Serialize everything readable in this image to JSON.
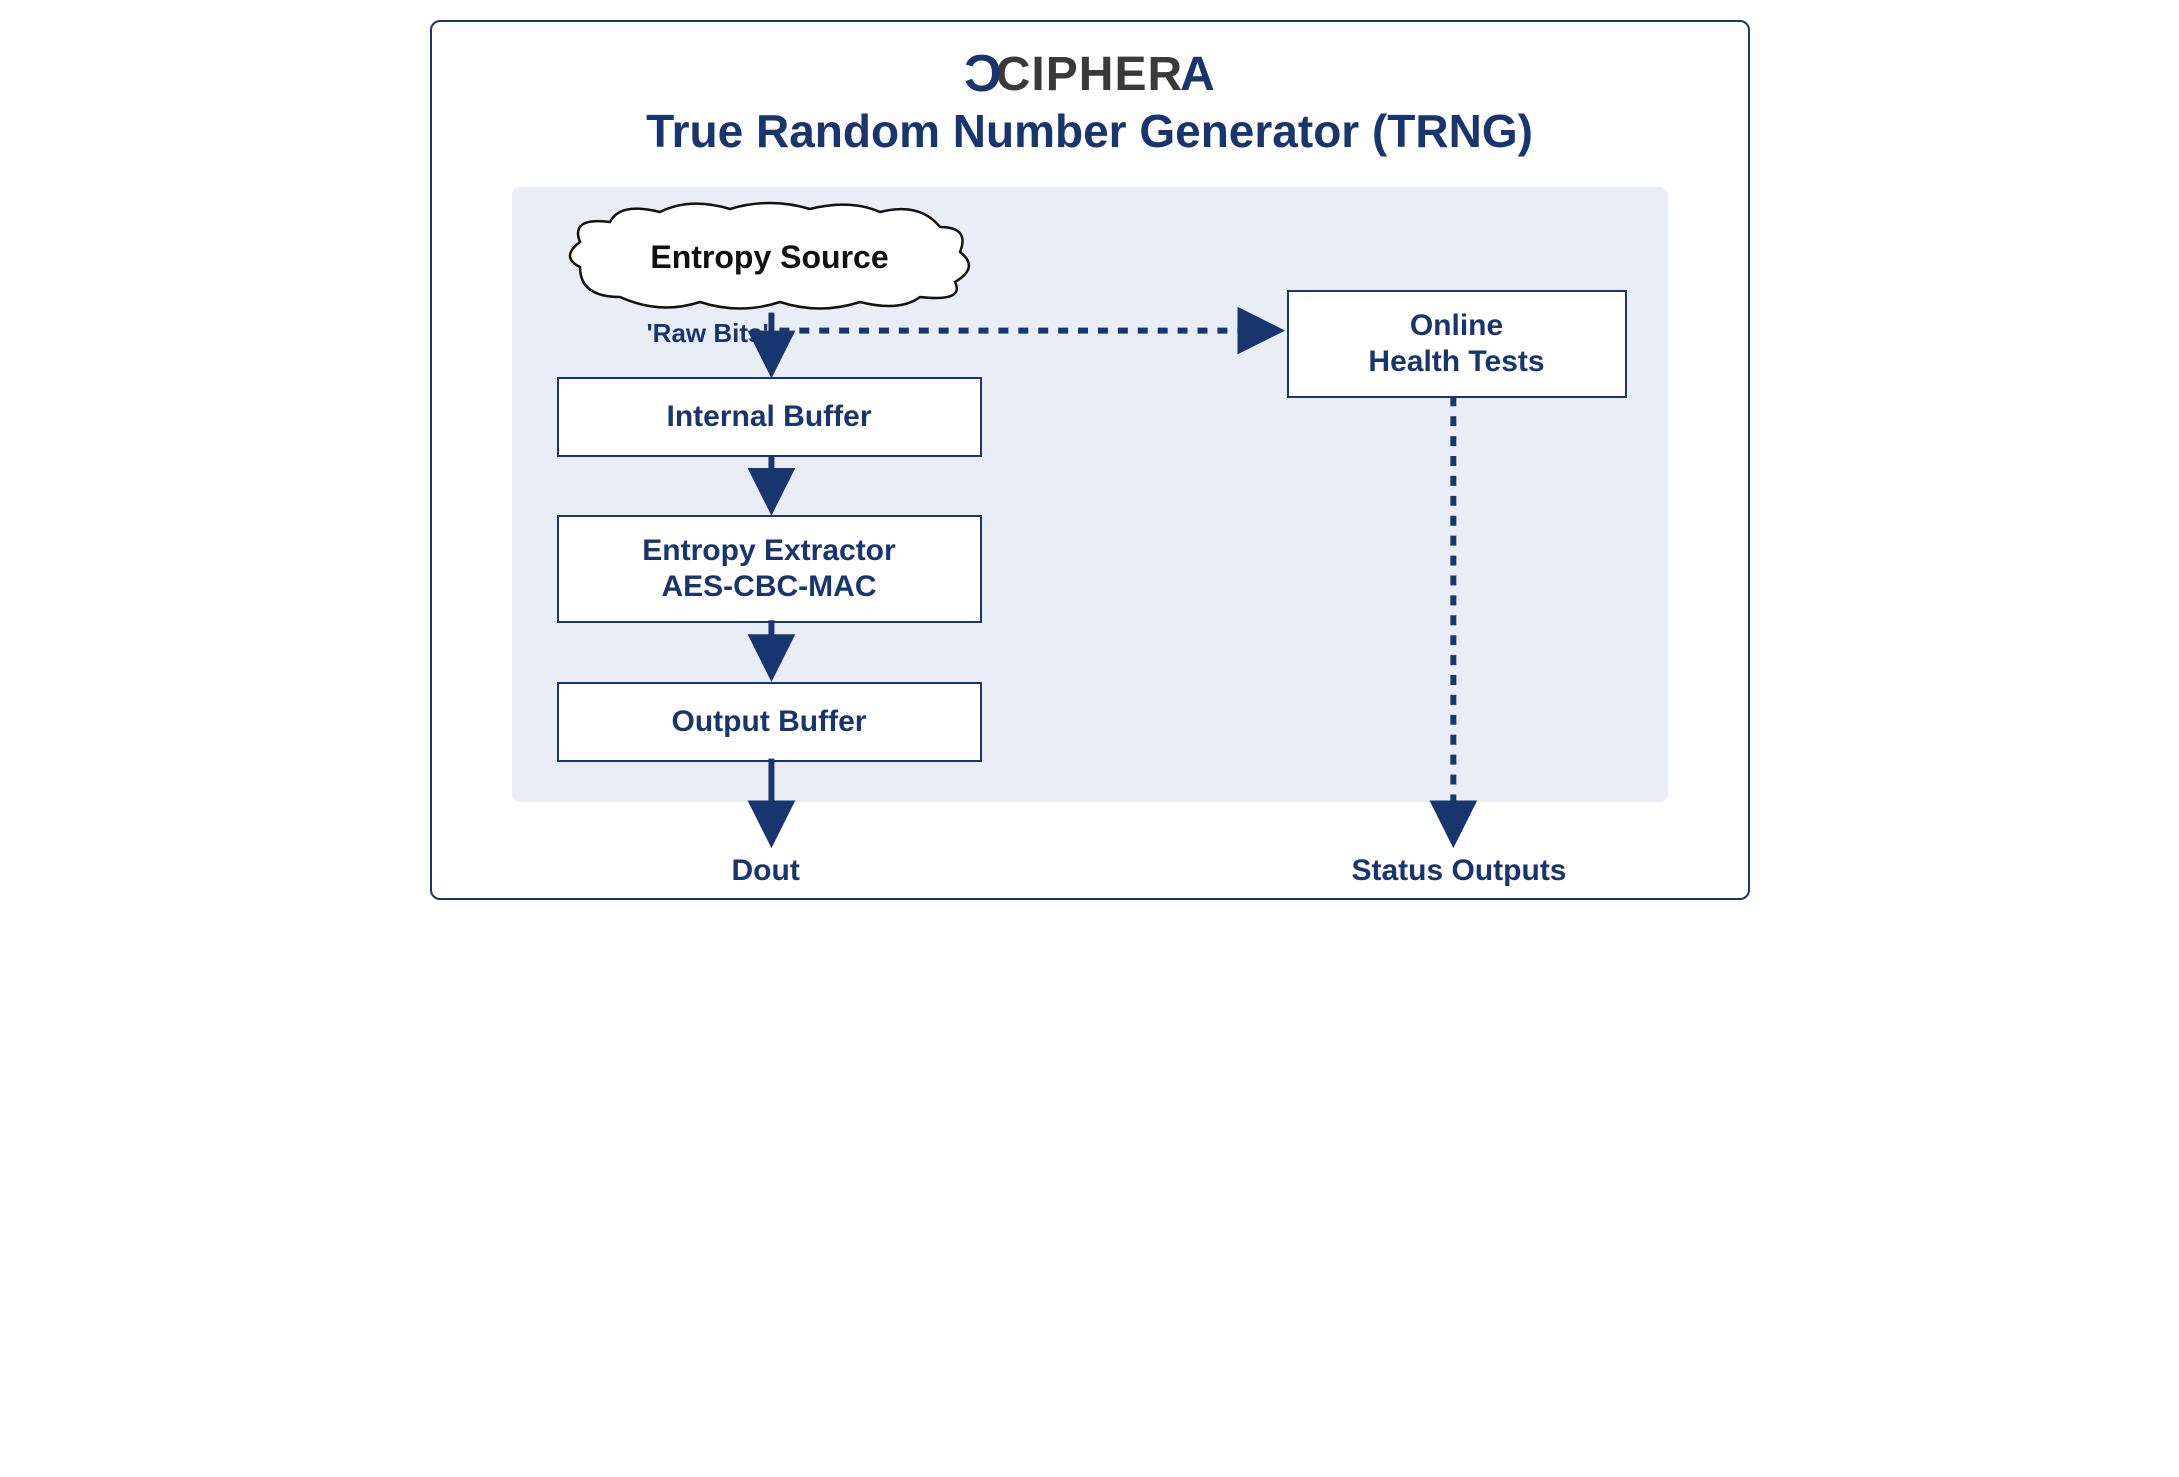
{
  "logo": {
    "x": "C",
    "middle": "CIPHER",
    "a": "A"
  },
  "title": "True Random Number Generator (TRNG)",
  "nodes": {
    "entropy_source": "Entropy Source",
    "raw_bits": "'Raw Bits'",
    "internal_buffer": "Internal Buffer",
    "entropy_extractor_line1": "Entropy Extractor",
    "entropy_extractor_line2": "AES-CBC-MAC",
    "output_buffer": "Output Buffer",
    "health_tests_line1": "Online",
    "health_tests_line2": "Health Tests"
  },
  "outputs": {
    "dout": "Dout",
    "status": "Status Outputs"
  },
  "colors": {
    "navy": "#18356f",
    "panel": "#e8edf6"
  }
}
